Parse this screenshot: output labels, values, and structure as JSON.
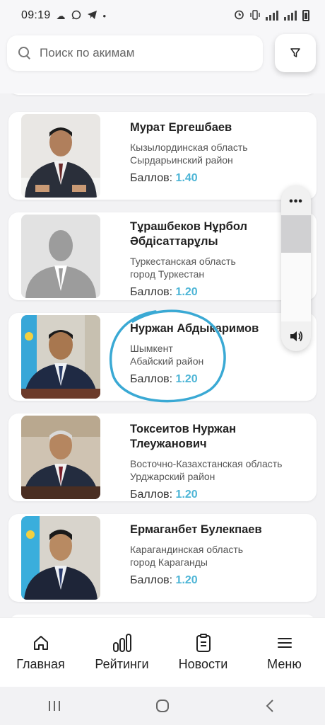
{
  "status_bar": {
    "time": "09:19",
    "left_icons": [
      "cloud-icon",
      "whatsapp-icon",
      "telegram-icon",
      "dot-icon"
    ],
    "right_icons": [
      "alarm-icon",
      "vibrate-icon",
      "wifi-signal-icon",
      "cell-signal-icon",
      "battery-icon"
    ]
  },
  "search": {
    "placeholder": "Поиск по акимам",
    "value": ""
  },
  "filter_icon": "filter-icon",
  "score_label": "Баллов:",
  "cards": [
    {
      "name": "Мурат Ергешбаев",
      "region_line1": "Кызылординская область",
      "region_line2": "Сырдарьинский район",
      "score": "1.40",
      "photo": "portrait"
    },
    {
      "name": "Тұрашбеков Нұрбол Әбдісаттарұлы",
      "region_line1": "Туркестанская область",
      "region_line2": "город Туркестан",
      "score": "1.20",
      "photo": "placeholder"
    },
    {
      "name": "Нуржан Абдыкаримов",
      "region_line1": "Шымкент",
      "region_line2": "Абайский район",
      "score": "1.20",
      "photo": "portrait-flag"
    },
    {
      "name": "Токсеитов Нуржан Тлеужанович",
      "region_line1": "Восточно-Казахстанская область",
      "region_line2": "Урджарский район",
      "score": "1.20",
      "photo": "portrait"
    },
    {
      "name": "Ермаганбет Булекпаев",
      "region_line1": "Карагандинская область",
      "region_line2": "город Караганды",
      "score": "1.20",
      "photo": "portrait-flag"
    }
  ],
  "volume": {
    "level": 0.35,
    "menu_label": "•••"
  },
  "bottom_nav": [
    {
      "label": "Главная",
      "icon": "home-icon"
    },
    {
      "label": "Рейтинги",
      "icon": "ratings-icon"
    },
    {
      "label": "Новости",
      "icon": "news-icon"
    },
    {
      "label": "Меню",
      "icon": "menu-icon"
    }
  ],
  "system_nav": [
    "recent-apps-icon",
    "home-circle-icon",
    "back-icon"
  ],
  "colors": {
    "accent": "#4db5d6",
    "annotation": "#3aa9d4"
  }
}
